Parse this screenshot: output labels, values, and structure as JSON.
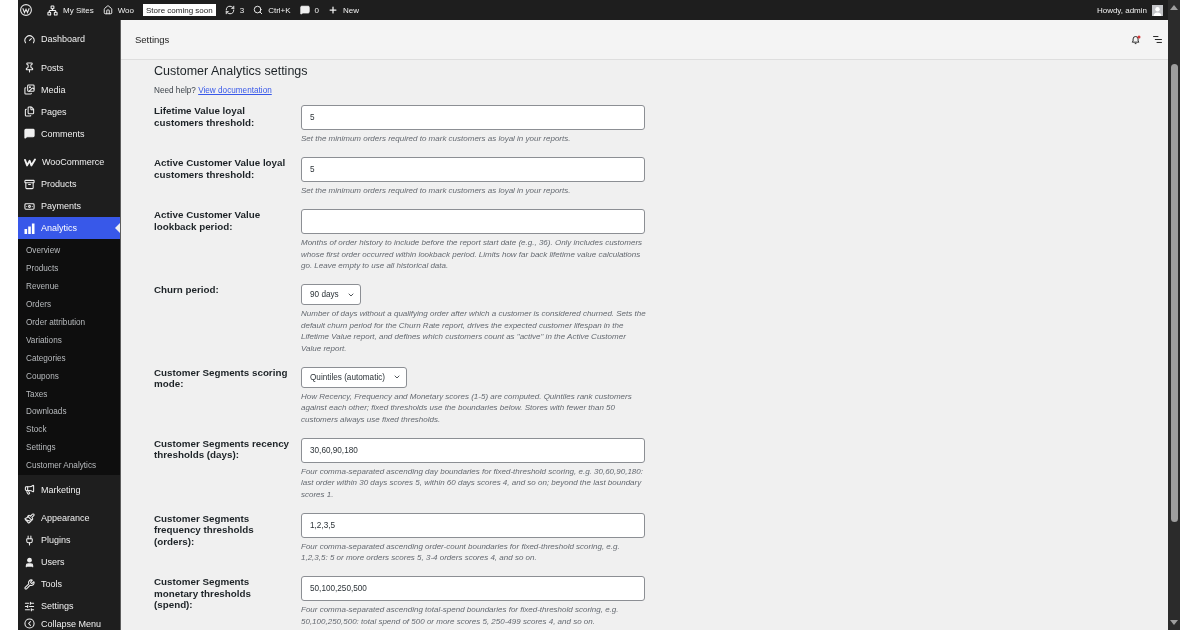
{
  "admin_bar": {
    "my_sites": "My Sites",
    "site_name": "Woo",
    "site_badge": "Store coming soon",
    "updates_count": "3",
    "search_shortcut": "Ctrl+K",
    "comments_count": "0",
    "new_label": "New",
    "greeting": "Howdy, admin"
  },
  "sidebar": {
    "groups": [
      {
        "items": [
          {
            "label": "Dashboard",
            "selected": false
          }
        ]
      },
      {
        "items": [
          {
            "label": "Posts",
            "selected": false
          },
          {
            "label": "Media",
            "selected": false
          },
          {
            "label": "Pages",
            "selected": false
          },
          {
            "label": "Comments",
            "selected": false
          }
        ]
      },
      {
        "items": [
          {
            "label": "WooCommerce",
            "selected": false
          },
          {
            "label": "Products",
            "selected": false
          },
          {
            "label": "Payments",
            "selected": false
          },
          {
            "label": "Analytics",
            "selected": true,
            "children": [
              {
                "label": "Overview",
                "selected": false
              },
              {
                "label": "Products",
                "selected": false
              },
              {
                "label": "Revenue",
                "selected": false
              },
              {
                "label": "Orders",
                "selected": false
              },
              {
                "label": "Order attribution",
                "selected": false
              },
              {
                "label": "Variations",
                "selected": false
              },
              {
                "label": "Categories",
                "selected": false
              },
              {
                "label": "Coupons",
                "selected": false
              },
              {
                "label": "Taxes",
                "selected": false
              },
              {
                "label": "Downloads",
                "selected": false
              },
              {
                "label": "Stock",
                "selected": false
              },
              {
                "label": "Settings",
                "selected": false
              },
              {
                "label": "Customer Analytics",
                "selected": false
              }
            ]
          },
          {
            "label": "Marketing",
            "selected": false
          }
        ]
      },
      {
        "items": [
          {
            "label": "Appearance",
            "selected": false
          },
          {
            "label": "Plugins",
            "selected": false
          },
          {
            "label": "Users",
            "selected": false
          },
          {
            "label": "Tools",
            "selected": false
          },
          {
            "label": "Settings",
            "selected": false
          }
        ]
      }
    ],
    "collapse_label": "Collapse Menu"
  },
  "header": {
    "title": "Settings"
  },
  "settings": {
    "title": "Customer Analytics settings",
    "help_prefix": "Need help?",
    "help_link": "View documentation",
    "fields": [
      {
        "kind": "text",
        "label": "Lifetime Value loyal customers threshold:",
        "value": "5",
        "description": "Set the minimum orders required to mark customers as loyal in your reports."
      },
      {
        "kind": "text",
        "label": "Active Customer Value loyal customers threshold:",
        "value": "5",
        "description": "Set the minimum orders required to mark customers as loyal in your reports."
      },
      {
        "kind": "text",
        "label": "Active Customer Value lookback period:",
        "description": "Months of order history to include before the report start date (e.g., 36). Only includes customers whose first order occurred within lookback period. Limits how far back lifetime value calculations go. Leave empty to use all historical data."
      },
      {
        "kind": "select",
        "label": "Churn period:",
        "value": "90 days",
        "description": "Number of days without a qualifying order after which a customer is considered churned. Sets the default churn period for the Churn Rate report, drives the expected customer lifespan in the Lifetime Value report, and defines which customers count as \"active\" in the Active Customer Value report."
      },
      {
        "kind": "select",
        "label": "Customer Segments scoring mode:",
        "value": "Quintiles (automatic)",
        "description": "How Recency, Frequency and Monetary scores (1-5) are computed. Quintiles rank customers against each other; fixed thresholds use the boundaries below. Stores with fewer than 50 customers always use fixed thresholds."
      },
      {
        "kind": "text",
        "label": "Customer Segments recency thresholds (days):",
        "value": "30,60,90,180",
        "description": "Four comma-separated ascending day boundaries for fixed-threshold scoring, e.g. 30,60,90,180: last order within 30 days scores 5, within 60 days scores 4, and so on; beyond the last boundary scores 1."
      },
      {
        "kind": "text",
        "label": "Customer Segments frequency thresholds (orders):",
        "value": "1,2,3,5",
        "description": "Four comma-separated ascending order-count boundaries for fixed-threshold scoring, e.g. 1,2,3,5: 5 or more orders scores 5, 3-4 orders scores 4, and so on."
      },
      {
        "kind": "text",
        "label": "Customer Segments monetary thresholds (spend):",
        "value": "50,100,250,500",
        "description": "Four comma-separated ascending total-spend boundaries for fixed-threshold scoring, e.g. 50,100,250,500: total spend of 500 or more scores 5, 250-499 scores 4, and so on."
      }
    ]
  }
}
